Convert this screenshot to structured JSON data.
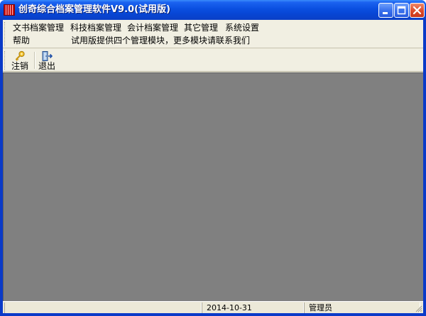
{
  "window": {
    "title": "创奇综合档案管理软件V9.0(试用版)",
    "controls": {
      "minimize": "minimize-icon",
      "maximize": "maximize-icon",
      "close": "close-icon"
    }
  },
  "menu": {
    "items": [
      {
        "label": "文书档案管理"
      },
      {
        "label": "科技档案管理"
      },
      {
        "label": "会计档案管理"
      },
      {
        "label": "其它管理"
      },
      {
        "label": "系统设置"
      },
      {
        "label": "帮助"
      }
    ],
    "notice": "试用版提供四个管理模块，更多模块请联系我们"
  },
  "toolbar": {
    "logout_label": "注销",
    "logout_icon": "key-icon",
    "exit_label": "退出",
    "exit_icon": "exit-door-icon"
  },
  "status": {
    "panel1": "",
    "date": "2014-10-31",
    "user": "管理员"
  },
  "colors": {
    "titlebar": "#0a4fe0",
    "workspace": "#808080",
    "chrome": "#ece9d8"
  }
}
